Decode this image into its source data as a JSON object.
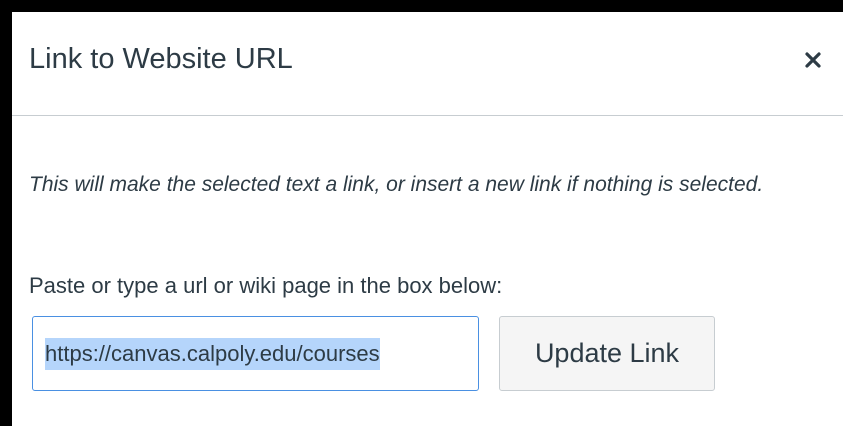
{
  "dialog": {
    "title": "Link to Website URL",
    "close_icon": "close-icon",
    "description": "This will make the selected text a link, or insert a new link if nothing is selected.",
    "instructions": "Paste or type a url or wiki page in the box below:",
    "url_input": {
      "value": "https://canvas.calpoly.edu/courses",
      "selected": true
    },
    "update_button_label": "Update Link"
  },
  "colors": {
    "text": "#2d3b45",
    "input_border": "#4a90e2",
    "selection": "#b5d5fb",
    "button_bg": "#f5f5f5",
    "backdrop": "#000000"
  }
}
